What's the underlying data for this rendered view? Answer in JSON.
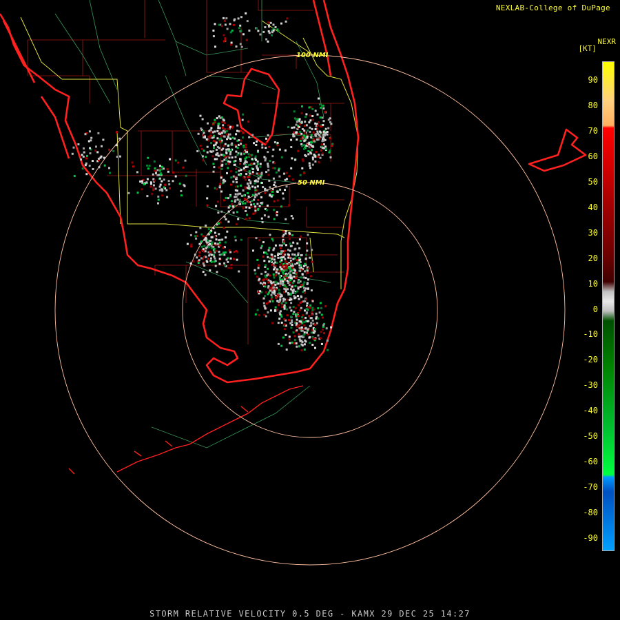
{
  "header": {
    "credit": "NEXLAB-College of DuPage",
    "product": "NEXR",
    "units": "[KT]"
  },
  "footer": {
    "caption": "STORM RELATIVE VELOCITY 0.5 DEG - KAMX 29 DEC 25 14:27"
  },
  "range_rings": [
    {
      "label": "100 NMI",
      "range_nmi": 100
    },
    {
      "label": "50 NMI",
      "range_nmi": 50
    }
  ],
  "legend": {
    "ticks": [
      90,
      80,
      70,
      60,
      50,
      40,
      30,
      20,
      10,
      0,
      -10,
      -20,
      -30,
      -40,
      -50,
      -60,
      -70,
      -80,
      -90
    ],
    "tick_labels": [
      "90",
      "80",
      "70",
      "60",
      "50",
      "40",
      "30",
      "20",
      "10",
      "0",
      "-10",
      "-20",
      "-30",
      "-40",
      "-50",
      "-60",
      "-70",
      "-80",
      "-90"
    ],
    "range": [
      -95,
      95
    ],
    "colors": {
      "outbound_high": "#ffff00",
      "outbound_mid": "#ff0000",
      "outbound_low": "#6a0000",
      "near_zero": "#c0c0c0",
      "inbound_low": "#005000",
      "inbound_mid": "#00ff40",
      "inbound_high": "#0099ff"
    }
  },
  "map_colors": {
    "coastline": "#ff2020",
    "county_lines": "#b02020",
    "highways": "#e0e040",
    "minor_roads": "#40a060",
    "range_rings": "#ffc0a0"
  }
}
